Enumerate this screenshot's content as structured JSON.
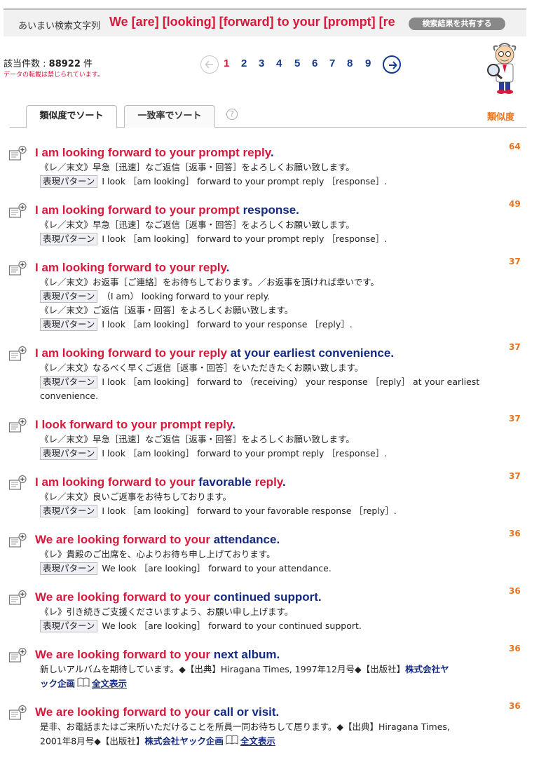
{
  "header": {
    "label": "あいまい検索文字列",
    "query": "We [are] [looking] [forward] to your [prompt] [re",
    "share_button": "検索結果を共有する"
  },
  "summary": {
    "count_label": "該当件数 : ",
    "count_value": "88922",
    "count_unit": " 件",
    "notice": "データの転載は禁じられています。"
  },
  "pagination": {
    "current": "1",
    "pages": [
      "2",
      "3",
      "4",
      "5",
      "6",
      "7",
      "8",
      "9"
    ],
    "prev_icon": "arrow-left-circle-icon",
    "next_icon": "arrow-right-circle-icon"
  },
  "tabs": {
    "sort_similarity": "類似度でソート",
    "sort_match": "一致率でソート",
    "help": "?",
    "column_label": "類似度"
  },
  "pattern_label": "表現パターン",
  "fulltext_label": "全文表示",
  "results": [
    {
      "title": [
        {
          "t": "I am looking forward to your prompt reply",
          "c": "red"
        },
        {
          "t": ".",
          "c": "blue"
        }
      ],
      "score": "64",
      "lines": [
        "《レ／末文》早急［迅速］なご返信［返事・回答］をよろしくお願い致します。"
      ],
      "patterns": [
        "I look ［am looking］ forward to your prompt reply ［response］."
      ]
    },
    {
      "title": [
        {
          "t": "I am looking forward to your prompt ",
          "c": "red"
        },
        {
          "t": "response.",
          "c": "blue"
        }
      ],
      "score": "49",
      "lines": [
        "《レ／末文》早急［迅速］なご返信［返事・回答］をよろしくお願い致します。"
      ],
      "patterns": [
        "I look ［am looking］ forward to your prompt reply ［response］."
      ]
    },
    {
      "title": [
        {
          "t": "I am looking forward to your reply",
          "c": "red"
        },
        {
          "t": ".",
          "c": "blue"
        }
      ],
      "score": "37",
      "lines": [
        "《レ／末文》お返事［ご連絡］をお待ちしております。／お返事を頂ければ幸いです。",
        "《レ／末文》ご返信［返事・回答］をよろしくお願い致します。"
      ],
      "patterns": [
        "（I am） looking forward to your reply.",
        "I look ［am looking］ forward to your response ［reply］."
      ]
    },
    {
      "title": [
        {
          "t": "I am looking forward to your reply",
          "c": "red"
        },
        {
          "t": " at your earliest convenience.",
          "c": "blue"
        }
      ],
      "score": "37",
      "lines": [
        "《レ／末文》なるべく早くご返信［返事・回答］をいただきたくお願い致します。"
      ],
      "patterns": [
        "I look ［am looking］ forward to （receiving） your response ［reply］ at your earliest"
      ],
      "continuation": "convenience."
    },
    {
      "title": [
        {
          "t": "I look forward to your prompt reply",
          "c": "red"
        },
        {
          "t": ".",
          "c": "blue"
        }
      ],
      "score": "37",
      "lines": [
        "《レ／末文》早急［迅速］なご返信［返事・回答］をよろしくお願い致します。"
      ],
      "patterns": [
        "I look ［am looking］ forward to your prompt reply ［response］."
      ]
    },
    {
      "title": [
        {
          "t": "I am looking forward to your ",
          "c": "red"
        },
        {
          "t": "favorable ",
          "c": "blue"
        },
        {
          "t": "reply",
          "c": "red"
        },
        {
          "t": ".",
          "c": "blue"
        }
      ],
      "score": "37",
      "lines": [
        "《レ／末文》良いご返事をお待ちしております。"
      ],
      "patterns": [
        "I look ［am looking］ forward to your favorable response ［reply］."
      ]
    },
    {
      "title": [
        {
          "t": "We are looking forward to your ",
          "c": "red"
        },
        {
          "t": "attendance.",
          "c": "blue"
        }
      ],
      "score": "36",
      "lines": [
        "《レ》貴殿のご出席を、心よりお待ち申し上げております。"
      ],
      "patterns": [
        "We look ［are looking］ forward to your attendance."
      ]
    },
    {
      "title": [
        {
          "t": "We are looking forward to your ",
          "c": "red"
        },
        {
          "t": "continued support.",
          "c": "blue"
        }
      ],
      "score": "36",
      "lines": [
        "《レ》引き続きご支援くださいますよう、お願い申し上げます。"
      ],
      "patterns": [
        "We look ［are looking］ forward to your continued support."
      ]
    },
    {
      "title": [
        {
          "t": "We are looking forward to your ",
          "c": "red"
        },
        {
          "t": "next album.",
          "c": "blue"
        }
      ],
      "score": "36",
      "source": {
        "line1_text": "新しいアルバムを期待しています。◆【出典】Hiragana Times, 1997年12月号◆【出版社】",
        "line1_link": "株式会社ヤ",
        "line2_link": "ック企画"
      }
    },
    {
      "title": [
        {
          "t": "We are looking forward to your ",
          "c": "red"
        },
        {
          "t": "call or visit.",
          "c": "blue"
        }
      ],
      "score": "36",
      "source": {
        "line1_text": "是非、お電話またはご来所いただけることを所員一同お待ちして居ります。◆【出典】Hiragana Times,",
        "line2_text": "2001年8月号◆【出版社】",
        "line2_link": "株式会社ヤック企画"
      }
    }
  ],
  "colors": {
    "red": "#d9183b",
    "blue": "#142a82",
    "orange": "#e8741e"
  }
}
